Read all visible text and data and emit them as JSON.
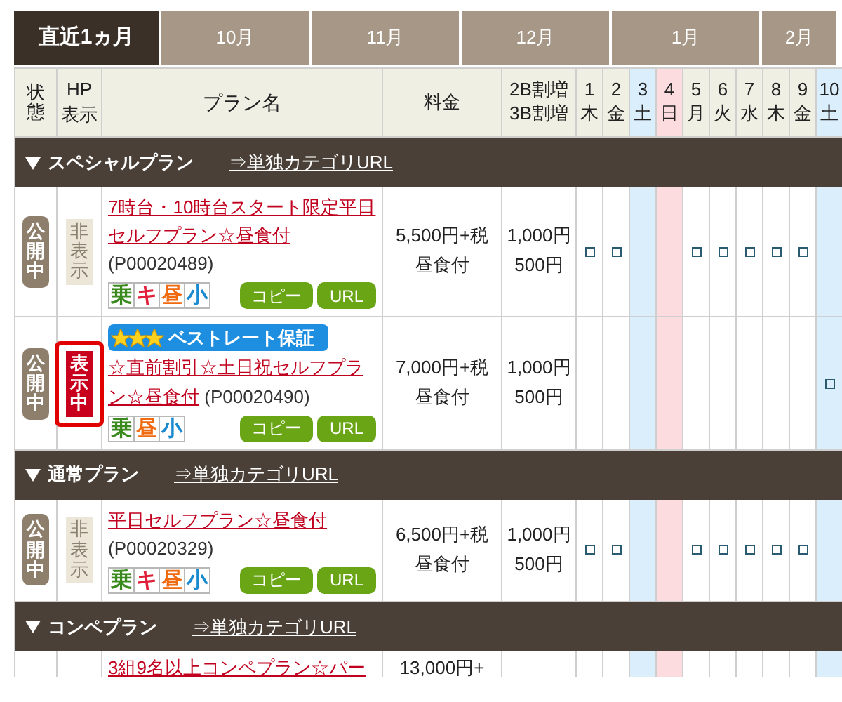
{
  "tabs": [
    {
      "label": "直近1ヵ月",
      "selected": true
    },
    {
      "label": "10月",
      "selected": false
    },
    {
      "label": "11月",
      "selected": false
    },
    {
      "label": "12月",
      "selected": false
    },
    {
      "label": "1月",
      "selected": false
    },
    {
      "label": "2月",
      "selected": false
    }
  ],
  "header": {
    "status": "状態",
    "hp": [
      "HP",
      "表示"
    ],
    "plan_name": "プラン名",
    "price": "料金",
    "surcharge": [
      "2B割増",
      "3B割増"
    ],
    "days": [
      {
        "num": "1",
        "weekday": "木",
        "kind": "weekday"
      },
      {
        "num": "2",
        "weekday": "金",
        "kind": "weekday"
      },
      {
        "num": "3",
        "weekday": "土",
        "kind": "saturday"
      },
      {
        "num": "4",
        "weekday": "日",
        "kind": "sunday"
      },
      {
        "num": "5",
        "weekday": "月",
        "kind": "weekday"
      },
      {
        "num": "6",
        "weekday": "火",
        "kind": "weekday"
      },
      {
        "num": "7",
        "weekday": "水",
        "kind": "weekday"
      },
      {
        "num": "8",
        "weekday": "木",
        "kind": "weekday"
      },
      {
        "num": "9",
        "weekday": "金",
        "kind": "weekday"
      },
      {
        "num": "10",
        "weekday": "土",
        "kind": "saturday"
      }
    ]
  },
  "sections": [
    {
      "title": "スペシャルプラン",
      "link": "⇒単独カテゴリURL",
      "expanded": true,
      "plans": [
        {
          "status": "公開中",
          "hp": {
            "label": "非表示",
            "shown": false
          },
          "highlighted": false,
          "name": "7時台・10時台スタート限定平日セルフプラン☆昼食付",
          "code": "(P00020489)",
          "tags": [
            {
              "label": "乗",
              "color": "#3a8a1e"
            },
            {
              "label": "キ",
              "color": "#e0203a"
            },
            {
              "label": "昼",
              "color": "#f06a10"
            },
            {
              "label": "小",
              "color": "#1a8ad0"
            }
          ],
          "buttons": [
            "コピー",
            "URL"
          ],
          "price": [
            "5,500円+税",
            "昼食付"
          ],
          "surcharge": [
            "1,000円",
            "500円"
          ],
          "days": [
            {
              "open": true
            },
            {
              "open": true
            },
            {
              "open": false
            },
            {
              "open": false
            },
            {
              "open": true
            },
            {
              "open": true
            },
            {
              "open": true
            },
            {
              "open": true
            },
            {
              "open": true
            },
            {
              "open": false
            }
          ]
        },
        {
          "status": "公開中",
          "hp": {
            "label": "表示中",
            "shown": true
          },
          "highlighted": true,
          "badge": "ベストレート保証",
          "name": "☆直前割引☆土日祝セルフプラン☆昼食付",
          "code": "(P00020490)",
          "tags": [
            {
              "label": "乗",
              "color": "#3a8a1e"
            },
            {
              "label": "昼",
              "color": "#f06a10"
            },
            {
              "label": "小",
              "color": "#1a8ad0"
            }
          ],
          "buttons": [
            "コピー",
            "URL"
          ],
          "price": [
            "7,000円+税",
            "昼食付"
          ],
          "surcharge": [
            "1,000円",
            "500円"
          ],
          "days": [
            {
              "open": false
            },
            {
              "open": false
            },
            {
              "open": false
            },
            {
              "open": false
            },
            {
              "open": false
            },
            {
              "open": false
            },
            {
              "open": false
            },
            {
              "open": false
            },
            {
              "open": false
            },
            {
              "open": true
            }
          ]
        }
      ]
    },
    {
      "title": "通常プラン",
      "link": "⇒単独カテゴリURL",
      "expanded": true,
      "plans": [
        {
          "status": "公開中",
          "hp": {
            "label": "非表示",
            "shown": false
          },
          "highlighted": false,
          "name": "平日セルフプラン☆昼食付",
          "code": "(P00020329)",
          "tags": [
            {
              "label": "乗",
              "color": "#3a8a1e"
            },
            {
              "label": "キ",
              "color": "#e0203a"
            },
            {
              "label": "昼",
              "color": "#f06a10"
            },
            {
              "label": "小",
              "color": "#1a8ad0"
            }
          ],
          "buttons": [
            "コピー",
            "URL"
          ],
          "price": [
            "6,500円+税",
            "昼食付"
          ],
          "surcharge": [
            "1,000円",
            "500円"
          ],
          "days": [
            {
              "open": true
            },
            {
              "open": true
            },
            {
              "open": false
            },
            {
              "open": false
            },
            {
              "open": true
            },
            {
              "open": true
            },
            {
              "open": true
            },
            {
              "open": true
            },
            {
              "open": true
            },
            {
              "open": false
            }
          ]
        }
      ]
    },
    {
      "title": "コンペプラン",
      "link": "⇒単独カテゴリURL",
      "expanded": true,
      "plans": [
        {
          "name": "3組9名以上コンペプラン☆パー",
          "price": [
            "13,000円+"
          ]
        }
      ]
    }
  ]
}
